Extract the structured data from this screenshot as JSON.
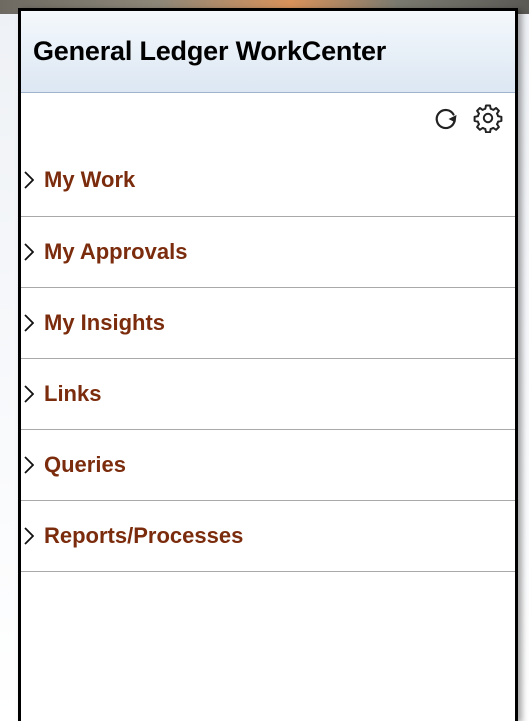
{
  "panel": {
    "title": "General Ledger WorkCenter"
  },
  "toolbar": {
    "refresh_icon": "refresh-icon",
    "settings_icon": "gear-icon"
  },
  "nav": {
    "items": [
      {
        "label": "My Work"
      },
      {
        "label": "My Approvals"
      },
      {
        "label": "My Insights"
      },
      {
        "label": "Links"
      },
      {
        "label": "Queries"
      },
      {
        "label": "Reports/Processes"
      }
    ]
  },
  "colors": {
    "header_top": "#f4f8fc",
    "header_bottom": "#dce7f3",
    "nav_label": "#7b2c0d",
    "divider": "#a9a9a9"
  }
}
